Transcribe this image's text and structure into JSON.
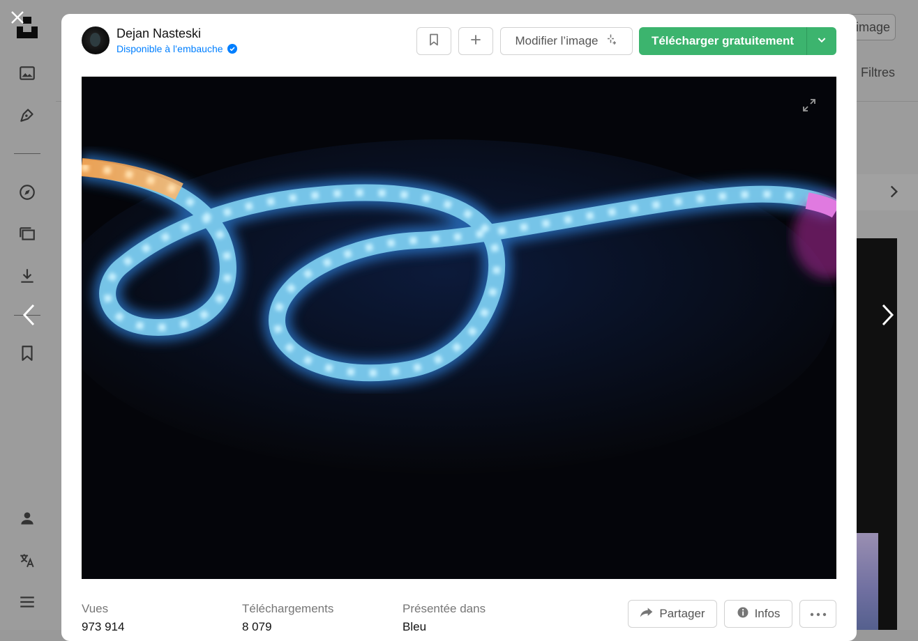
{
  "background_page": {
    "search_by_image_label": "image",
    "filters_label": "Filtres"
  },
  "modal": {
    "author": {
      "name": "Dejan Nasteski",
      "hire_status": "Disponible à l’embauche"
    },
    "actions": {
      "edit_label": "Modifier l’image",
      "download_label": "Télécharger gratuitement",
      "share_label": "Partager",
      "info_label": "Infos"
    },
    "stats": [
      {
        "label": "Vues",
        "value": "973 914"
      },
      {
        "label": "Téléchargements",
        "value": "8 079"
      },
      {
        "label": "Présentée dans",
        "value": "Bleu"
      }
    ]
  },
  "colors": {
    "download_green": "#3cb46e",
    "link_blue": "#007fff"
  },
  "icons": [
    "close-icon",
    "unsplash-logo",
    "image-icon",
    "pen-icon",
    "compass-icon",
    "collections-icon",
    "download-icon",
    "bookmark-icon",
    "user-icon",
    "translate-icon",
    "menu-icon",
    "chevron-left-icon",
    "chevron-right-icon",
    "plus-icon",
    "sparkle-icon",
    "chevron-down-icon",
    "expand-icon",
    "share-arrow-icon",
    "info-icon",
    "more-icon",
    "verified-badge-icon"
  ]
}
